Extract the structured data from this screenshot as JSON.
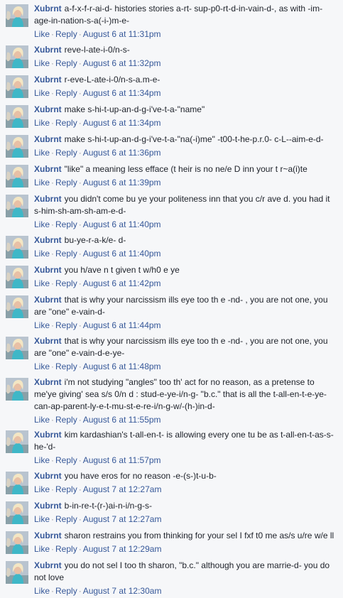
{
  "labels": {
    "like": "Like",
    "reply": "Reply",
    "separator": "·"
  },
  "comments": [
    {
      "author": "Xubrnt",
      "text": "a-f-x-f-r-ai-d- histories stories a-rt- sup-p0-rt-d-in-vain-d-, as with -im-age-in-nation-s-a(-i-)m-e-",
      "time": "August 6 at 11:31pm"
    },
    {
      "author": "Xubrnt",
      "text": "reve-l-ate-i-0/n-s-",
      "time": "August 6 at 11:32pm"
    },
    {
      "author": "Xubrnt",
      "text": "r-eve-L-ate-i-0/n-s-a.m-e-",
      "time": "August 6 at 11:34pm"
    },
    {
      "author": "Xubrnt",
      "text": "make s-hi-t-up-an-d-g-i've-t-a-\"name\"",
      "time": "August 6 at 11:34pm"
    },
    {
      "author": "Xubrnt",
      "text": "make s-hi-t-up-an-d-g-i've-t-a-\"na(-i)me\" -t00-t-he-p.r.0- c-L--aim-e-d-",
      "time": "August 6 at 11:36pm"
    },
    {
      "author": "Xubrnt",
      "text": "\"like\" a meaning less efface (t heir is no ne/e D inn your t r~a(i)te",
      "time": "August 6 at 11:39pm"
    },
    {
      "author": "Xubrnt",
      "text": "you didn't come bu ye your politeness inn that you c/r ave d. you had it s-him-sh-am-sh-am-e-d-",
      "time": "August 6 at 11:40pm"
    },
    {
      "author": "Xubrnt",
      "text": "bu-ye-r-a-k/e- d-",
      "time": "August 6 at 11:40pm"
    },
    {
      "author": "Xubrnt",
      "text": "you h/ave n t given t w/h0 e ye",
      "time": "August 6 at 11:42pm"
    },
    {
      "author": "Xubrnt",
      "text": "that is why your narcissism ills eye too th e -nd- , you are not one, you are \"one\" e-vain-d-",
      "time": "August 6 at 11:44pm"
    },
    {
      "author": "Xubrnt",
      "text": "that is why your narcissism ills eye too th e -nd- , you are not one, you are \"one\" e-vain-d-e-ye-",
      "time": "August 6 at 11:48pm"
    },
    {
      "author": "Xubrnt",
      "text": "i'm not studying \"angles\" too th' act for no reason, as a pretense to me'ye giving' sea s/s 0/n d : stud-e-ye-i/n-g- \"b.c.\" that is all the t-all-en-t-e-ye-can-ap-parent-ly-e-t-mu-st-e-re-i/n-g-w/-(h-)in-d-",
      "time": "August 6 at 11:55pm"
    },
    {
      "author": "Xubrnt",
      "text": "kim kardashian's t-all-en-t- is allowing every one tu be as t-all-en-t-as-s-he-'d-",
      "time": "August 6 at 11:57pm"
    },
    {
      "author": "Xubrnt",
      "text": "you have eros for no reason -e-(s-)t-u-b-",
      "time": "August 7 at 12:27am"
    },
    {
      "author": "Xubrnt",
      "text": "b-in-re-t-(r-)ai-n-i/n-g-s-",
      "time": "August 7 at 12:27am"
    },
    {
      "author": "Xubrnt",
      "text": "sharon restrains you from thinking for your sel I fxf t0 me as/s u/re w/e ll",
      "time": "August 7 at 12:29am"
    },
    {
      "author": "Xubrnt",
      "text": "you do not sel I too th sharon, \"b.c.\" although you are marrie-d- you do not love",
      "time": "August 7 at 12:30am"
    }
  ]
}
